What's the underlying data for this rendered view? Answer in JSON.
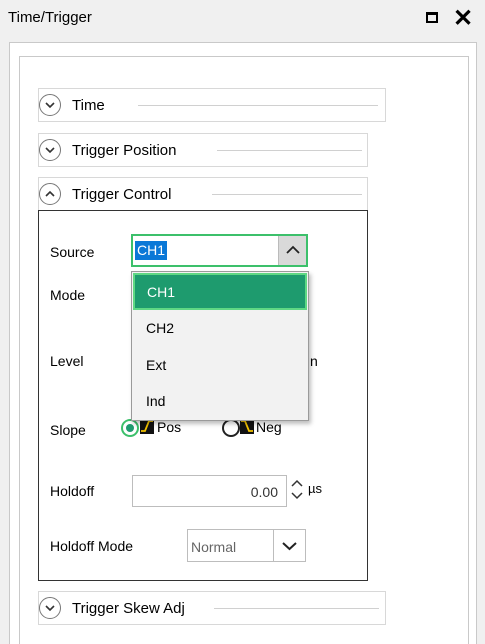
{
  "window": {
    "title": "Time/Trigger",
    "maximize_icon": "maximize-icon",
    "close_icon": "close-icon"
  },
  "sections": {
    "time": {
      "label": "Time",
      "state": "collapsed"
    },
    "trigger_position": {
      "label": "Trigger Position",
      "state": "collapsed"
    },
    "trigger_control": {
      "label": "Trigger Control",
      "state": "expanded"
    },
    "trigger_skew": {
      "label": "Trigger Skew Adj",
      "state": "collapsed"
    }
  },
  "trigger_control": {
    "source_label": "Source",
    "source_value": "CH1",
    "source_options": [
      "CH1",
      "CH2",
      "Ext",
      "Ind"
    ],
    "mode_label": "Mode",
    "level_label": "Level",
    "level_partial_text": "n",
    "slope_label": "Slope",
    "slope_pos": "Pos",
    "slope_neg": "Neg",
    "slope_selected": "Pos",
    "holdoff_label": "Holdoff",
    "holdoff_value": "0.00",
    "holdoff_unit": "µs",
    "holdoff_mode_label": "Holdoff Mode",
    "holdoff_mode_value": "Normal"
  },
  "colors": {
    "accent_green": "#3cc06b",
    "selected_item_bg": "#1e9b6e",
    "text_highlight": "#0a78d7",
    "slope_icon_line": "#f2c200"
  }
}
